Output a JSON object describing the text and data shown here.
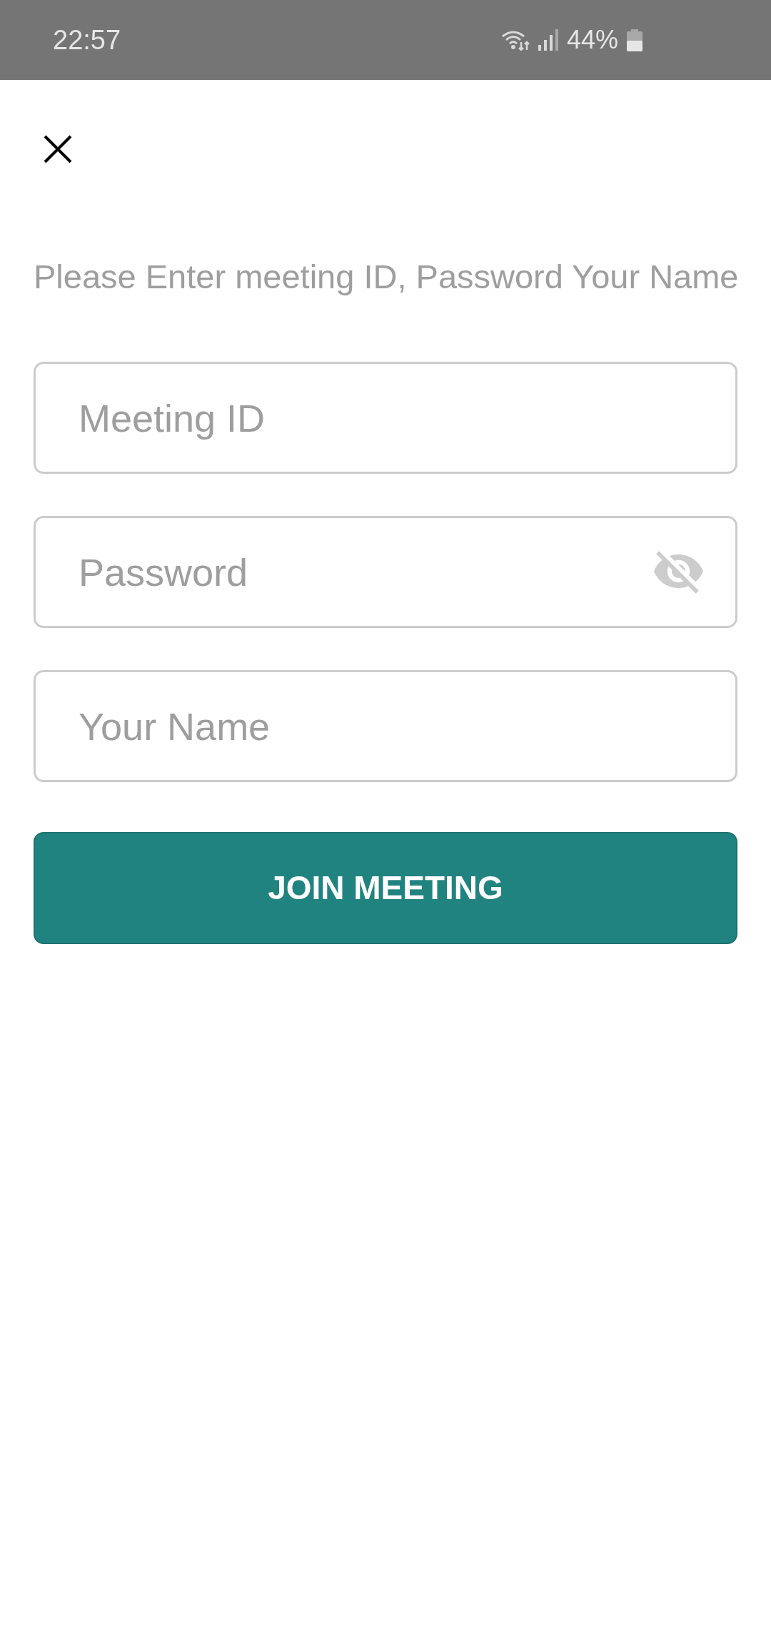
{
  "status_bar": {
    "time": "22:57",
    "battery": "44%"
  },
  "instruction": "Please Enter meeting ID, Password Your Name",
  "fields": [
    {
      "kind": "text",
      "placeholder": "Meeting ID"
    },
    {
      "kind": "password",
      "placeholder": "Password"
    },
    {
      "kind": "text",
      "placeholder": "Your Name"
    }
  ],
  "button": {
    "label": "JOIN MEETING"
  }
}
